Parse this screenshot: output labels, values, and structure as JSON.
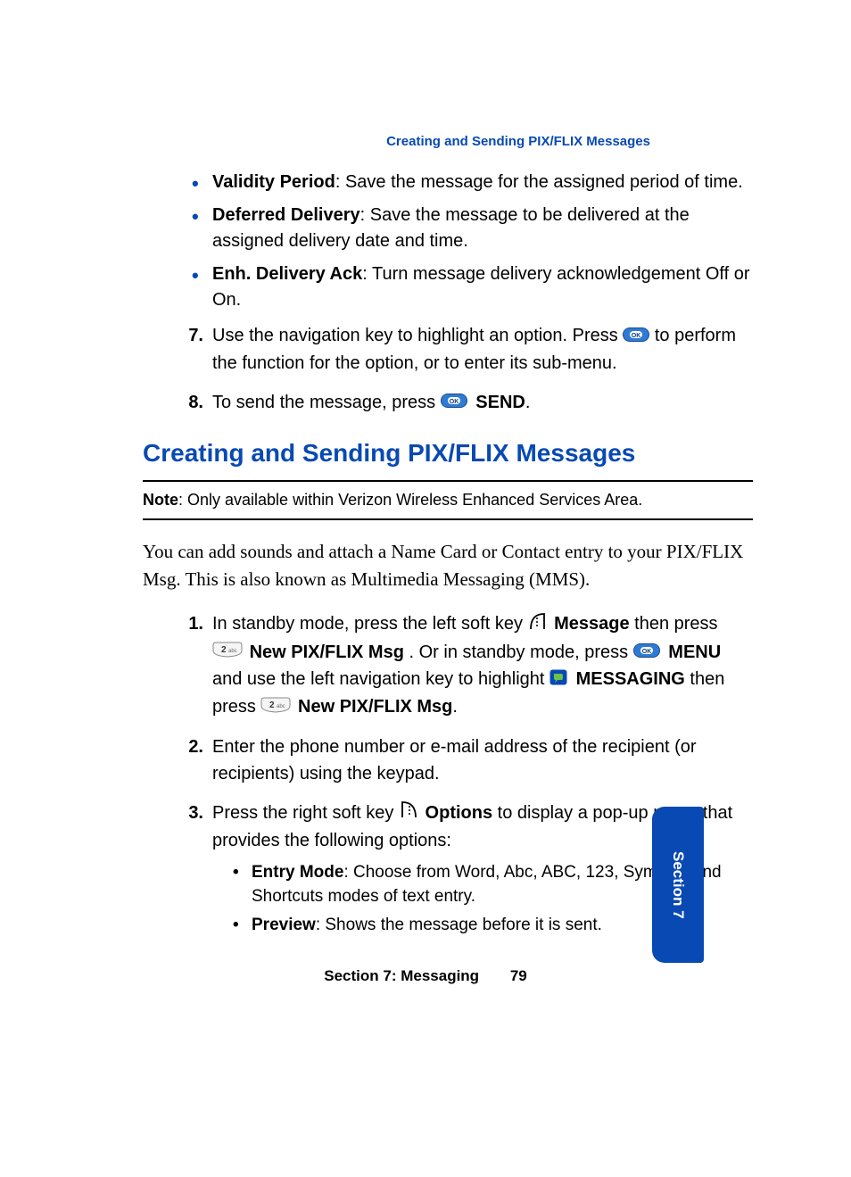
{
  "header": "Creating and Sending PIX/FLIX Messages",
  "bullets": [
    {
      "term": "Validity Period",
      "desc": ": Save the message for the assigned period of time."
    },
    {
      "term": "Deferred Delivery",
      "desc": ": Save the message to be delivered at the assigned delivery date and time."
    },
    {
      "term": "Enh. Delivery Ack",
      "desc": ": Turn message delivery acknowledgement Off or On."
    }
  ],
  "top_steps": {
    "s7": {
      "num": "7.",
      "pre": "Use the navigation key to highlight an option. Press ",
      "post": " to perform the function for the option, or to enter its sub-menu."
    },
    "s8": {
      "num": "8.",
      "pre": "To send the message, press ",
      "send": "SEND",
      "post": "."
    }
  },
  "section_title": "Creating and Sending PIX/FLIX Messages",
  "note": {
    "label": "Note",
    "text": ": Only available within Verizon Wireless Enhanced Services Area."
  },
  "intro": "You can add sounds and attach a Name Card or Contact entry to your PIX/FLIX Msg. This is also known as Multimedia Messaging (MMS).",
  "main_steps": {
    "s1": {
      "num": "1.",
      "a": "In standby mode, press the left soft key ",
      "message": "Message",
      "b": " then press ",
      "newpix": "New PIX/FLIX Msg",
      "c": ". Or in standby mode, press ",
      "menu": "MENU",
      "d": " and use the left navigation key to highlight ",
      "messaging": "MESSAGING",
      "e": " then press ",
      "newpix2": "New PIX/FLIX Msg",
      "f": "."
    },
    "s2": {
      "num": "2.",
      "text": "Enter the phone number or e-mail address of the recipient (or recipients) using the keypad."
    },
    "s3": {
      "num": "3.",
      "a": "Press the right soft key ",
      "options": "Options",
      "b": " to display a pop-up menu that provides the following options:"
    }
  },
  "sub_bullets": [
    {
      "term": "Entry Mode",
      "desc": ": Choose from Word, Abc, ABC, 123, Symbols and Shortcuts modes of text entry."
    },
    {
      "term": "Preview",
      "desc": ": Shows the message before it is sent."
    }
  ],
  "footer": {
    "section": "Section 7: Messaging",
    "page": "79"
  },
  "side_tab": "Section 7"
}
